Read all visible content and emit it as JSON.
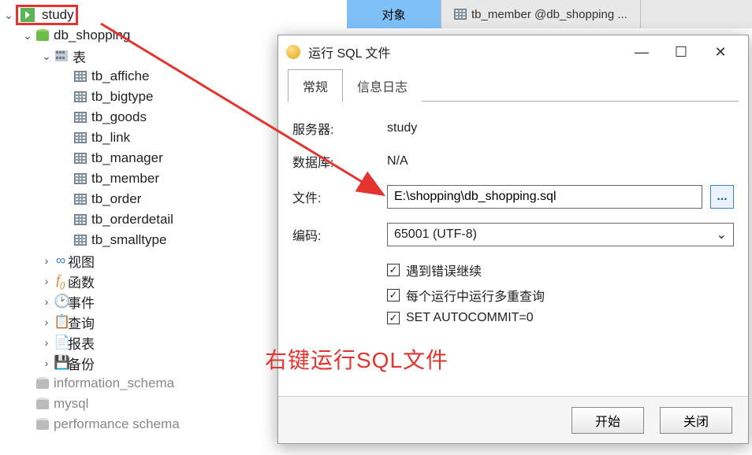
{
  "topbar": {
    "tabs": {
      "objects_label": "对象",
      "other_tab_label": "tb_member @db_shopping ..."
    }
  },
  "tree": {
    "connection": "study",
    "database": "db_shopping",
    "tables_folder_label": "表",
    "tables": [
      "tb_affiche",
      "tb_bigtype",
      "tb_goods",
      "tb_link",
      "tb_manager",
      "tb_member",
      "tb_order",
      "tb_orderdetail",
      "tb_smalltype"
    ],
    "views_label": "视图",
    "functions_label": "函数",
    "events_label": "事件",
    "queries_label": "查询",
    "reports_label": "报表",
    "backups_label": "备份",
    "other_dbs": [
      "information_schema",
      "mysql",
      "performance schema"
    ]
  },
  "dialog": {
    "title": "运行 SQL 文件",
    "tabs": {
      "general": "常规",
      "log": "信息日志"
    },
    "labels": {
      "server": "服务器:",
      "database": "数据库:",
      "file": "文件:",
      "encoding": "编码:"
    },
    "values": {
      "server": "study",
      "database": "N/A",
      "file": "E:\\shopping\\db_shopping.sql",
      "encoding": "65001 (UTF-8)"
    },
    "checks": {
      "continue_on_error": "遇到错误继续",
      "multi_queries": "每个运行中运行多重查询",
      "autocommit": "SET AUTOCOMMIT=0"
    },
    "buttons": {
      "start": "开始",
      "close": "关闭",
      "browse": "..."
    }
  },
  "annotation": {
    "text": "右键运行SQL文件"
  }
}
